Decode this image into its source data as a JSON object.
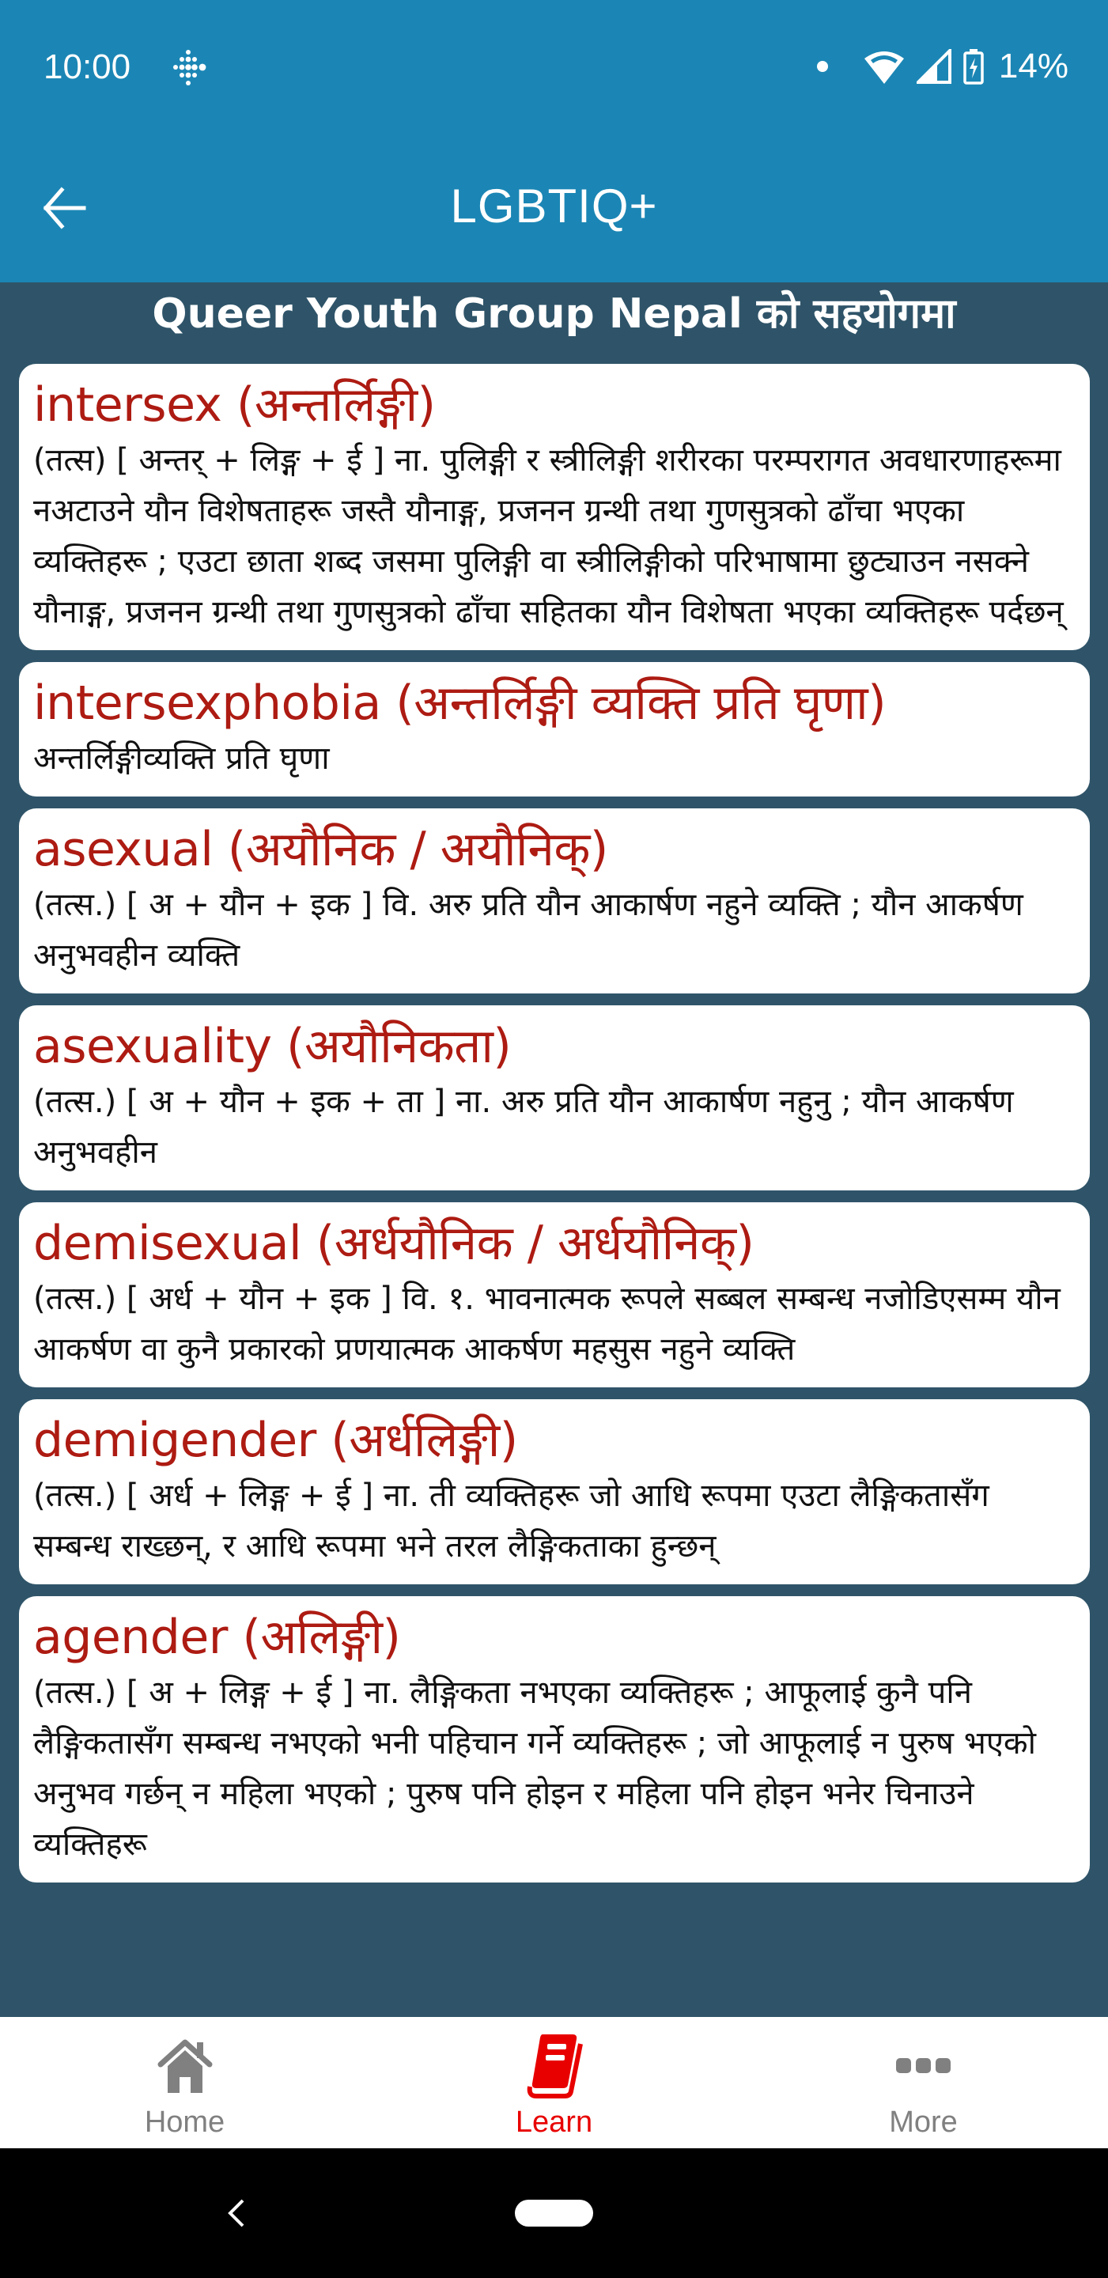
{
  "status_bar": {
    "time": "10:00",
    "notification_icon": "fitbit-dots-icon",
    "icons": [
      "notification-dot-icon",
      "wifi-icon",
      "cell-signal-icon",
      "battery-charging-icon"
    ],
    "battery_percent": "14%"
  },
  "app_bar": {
    "back_icon": "arrow-left-icon",
    "title": "LGBTIQ+"
  },
  "sponsor_banner": "Queer Youth Group Nepal को सहयोगमा",
  "terms": [
    {
      "title": "intersex (अन्तर्लिङ्गी)",
      "definition": "(तत्स) [ अन्तर् + लिङ्ग + ई ] ना. पुलिङ्गी र स्त्रीलिङ्गी शरीरका परम्परागत अवधारणाहरूमा नअटाउने यौन विशेषताहरू जस्तै यौनाङ्ग, प्रजनन ग्रन्थी तथा गुणसुत्रको ढाँचा भएका व्यक्तिहरू ; एउटा छाता शब्द जसमा पुलिङ्गी वा स्त्रीलिङ्गीको परिभाषामा छुट्याउन नसक्ने यौनाङ्ग, प्रजनन ग्रन्थी तथा गुणसुत्रको ढाँचा सहितका यौन विशेषता भएका व्यक्तिहरू पर्दछन्"
    },
    {
      "title": "intersexphobia (अन्तर्लिङ्गी व्यक्ति प्रति घृणा)",
      "definition": "अन्तर्लिङ्गीव्यक्ति प्रति घृणा"
    },
    {
      "title": "asexual (अयौनिक / अयौनिक्)",
      "definition": "(तत्स.) [ अ + यौन + इक ] वि. अरु प्रति यौन आकार्षण नहुने व्यक्ति ; यौन आकर्षण अनुभवहीन व्यक्ति"
    },
    {
      "title": "asexuality (अयौनिकता)",
      "definition": "(तत्स.) [ अ + यौन + इक + ता ] ना. अरु प्रति यौन आकार्षण नहुनु ; यौन आकर्षण अनुभवहीन"
    },
    {
      "title": "demisexual (अर्धयौनिक / अर्धयौनिक्)",
      "definition": "(तत्स.) [ अर्ध + यौन + इक ] वि. १. भावनात्मक रूपले सब्बल सम्बन्ध नजोडिएसम्म यौन आकर्षण वा कुनै प्रकारको प्रणयात्मक आकर्षण महसुस नहुने व्यक्ति"
    },
    {
      "title": "demigender (अर्धलिङ्गी)",
      "definition": "(तत्स.) [ अर्ध + लिङ्ग + ई ] ना. ती व्यक्तिहरू जो आधि रूपमा एउटा लैङ्गिकतासँग सम्बन्ध राख्छन्, र आधि रूपमा भने तरल लैङ्गिकताका हुन्छन्"
    },
    {
      "title": "agender (अलिङ्गी)",
      "definition": "(तत्स.) [ अ + लिङ्ग + ई ] ना. लैङ्गिकता नभएका व्यक्तिहरू ; आफूलाई कुनै पनि लैङ्गिकतासँग सम्बन्ध नभएको भनी पहिचान गर्ने व्यक्तिहरू ; जो आफूलाई न पुरुष भएको अनुभव गर्छन् न महिला भएको ; पुरुष पनि होइन र महिला पनि होइन भनेर चिनाउने व्यक्तिहरू"
    }
  ],
  "bottom_nav": {
    "items": [
      {
        "label": "Home",
        "icon": "home-icon",
        "active": false
      },
      {
        "label": "Learn",
        "icon": "book-icon",
        "active": true
      },
      {
        "label": "More",
        "icon": "more-dots-icon",
        "active": false
      }
    ]
  },
  "system_nav": {
    "back_icon": "system-back-icon",
    "home_icon": "system-home-pill"
  },
  "colors": {
    "app_bar": "#1b86b5",
    "background": "#2f5469",
    "term_title": "#ad1b12",
    "active_nav": "#e80000",
    "inactive_nav": "#808080"
  }
}
